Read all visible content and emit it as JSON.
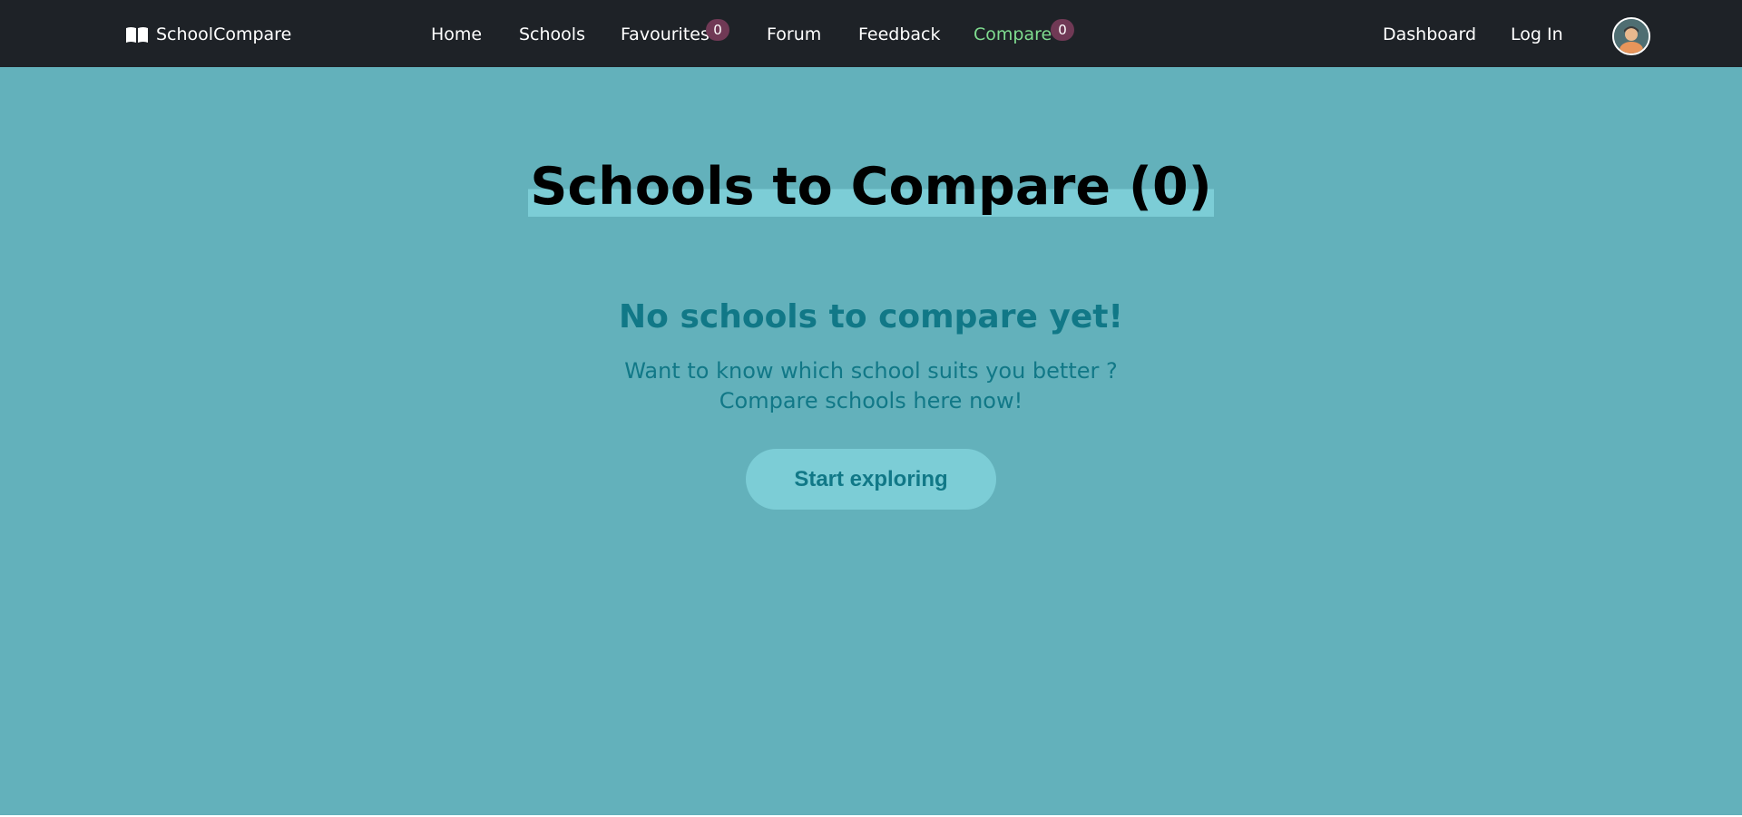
{
  "navbar": {
    "brand": {
      "label": "SchoolCompare",
      "icon": "open-book-icon"
    },
    "links": [
      {
        "label": "Home"
      },
      {
        "label": "Schools"
      },
      {
        "label": "Favourites",
        "badge": "0"
      },
      {
        "label": "Forum"
      },
      {
        "label": "Feedback"
      },
      {
        "label": "Compare",
        "badge": "0",
        "active": true
      }
    ],
    "right_links": [
      {
        "label": "Dashboard"
      },
      {
        "label": "Log In"
      }
    ],
    "avatar": {
      "icon": "user-avatar-icon"
    }
  },
  "main": {
    "title": "Schools to Compare (0)",
    "empty_heading": "No schools to compare yet!",
    "empty_lines": [
      "Want to know which school suits you better ?",
      "Compare schools here now!"
    ],
    "cta_label": "Start exploring"
  },
  "colors": {
    "navbar_bg": "#1e2227",
    "page_bg": "#63b1bb",
    "accent_teal": "#117887",
    "button_bg": "#7ccdd6",
    "active_link": "#7fdc8f",
    "badge_bg": "#703955"
  }
}
